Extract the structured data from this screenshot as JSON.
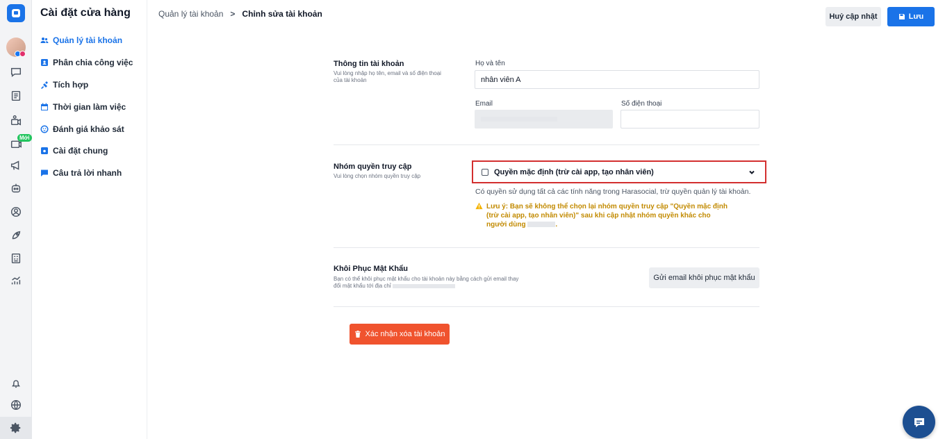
{
  "colors": {
    "accent": "#1a73e8",
    "danger": "#f0532e",
    "warning": "#c28a00",
    "highlight_border": "#d32f2f"
  },
  "rail": {
    "icons": [
      "chat-icon",
      "document-list-icon",
      "camera-icon",
      "livestream-icon",
      "megaphone-icon",
      "bot-icon",
      "user-circle-icon",
      "rocket-icon",
      "report-icon",
      "analytics-icon",
      "bell-icon",
      "globe-icon",
      "settings-gear-icon"
    ],
    "new_badge": "Mới"
  },
  "menu": {
    "title": "Cài đặt cửa hàng",
    "items": [
      {
        "label": "Quản lý tài khoản",
        "icon": "users-icon",
        "active": true
      },
      {
        "label": "Phân chia công việc",
        "icon": "id-card-icon",
        "active": false
      },
      {
        "label": "Tích hợp",
        "icon": "plug-icon",
        "active": false
      },
      {
        "label": "Thời gian làm việc",
        "icon": "calendar-icon",
        "active": false
      },
      {
        "label": "Đánh giá khảo sát",
        "icon": "survey-icon",
        "active": false
      },
      {
        "label": "Cài đặt chung",
        "icon": "store-icon",
        "active": false
      },
      {
        "label": "Câu trả lời nhanh",
        "icon": "message-icon",
        "active": false
      }
    ]
  },
  "header": {
    "breadcrumb_parent": "Quản lý tài khoản",
    "breadcrumb_sep": ">",
    "breadcrumb_current": "Chỉnh sửa tài khoản",
    "cancel_label": "Huỷ cập nhật",
    "save_label": "Lưu"
  },
  "account_info": {
    "title": "Thông tin tài khoản",
    "desc": "Vui lòng nhập họ tên, email và số điện thoại của tài khoản",
    "name_label": "Họ và tên",
    "name_value": "nhân viên A",
    "email_label": "Email",
    "phone_label": "Số điện thoại",
    "phone_value": ""
  },
  "access_group": {
    "title": "Nhóm quyền truy cập",
    "desc": "Vui lòng chọn nhóm quyền truy cập",
    "selected": "Quyền mặc định (trừ cài app, tạo nhân viên)",
    "permission_desc": "Có quyền sử dụng tất cả các tính năng trong Harasocial, trừ quyền quản lý tài khoản.",
    "warning_text": "Lưu ý: Bạn sẽ không thể chọn lại nhóm quyền truy cập \"Quyền mặc định (trừ cài app, tạo nhân viên)\" sau khi cập nhật nhóm quyền khác cho người dùng",
    "warning_end": "."
  },
  "password_reset": {
    "title": "Khôi Phục Mật Khẩu",
    "desc": "Bạn có thể khôi phục mật khẩu cho tài khoản này bằng cách gửi email thay đổi mật khẩu tới địa chỉ",
    "button_label": "Gửi email khôi phục mật khẩu"
  },
  "delete": {
    "button_label": "Xác nhận xóa tài khoản"
  }
}
